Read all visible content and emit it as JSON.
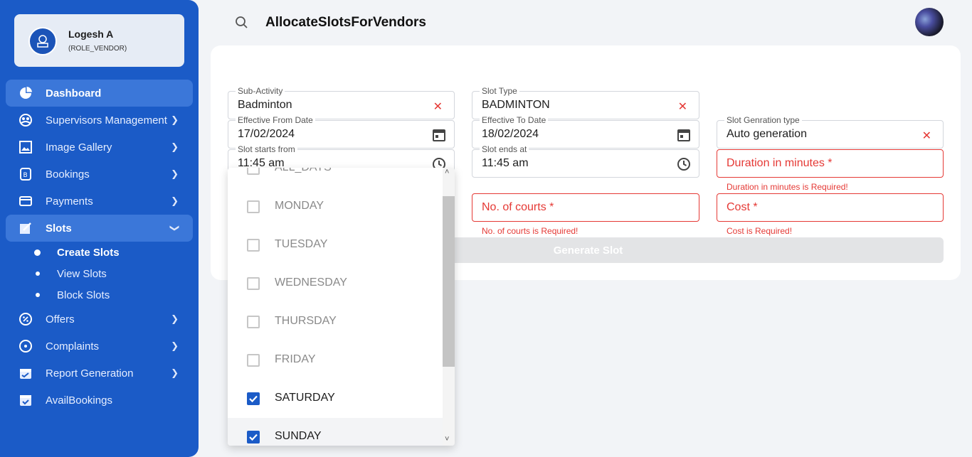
{
  "sidebar": {
    "profile": {
      "name": "Logesh A",
      "role": "(ROLE_VENDOR)"
    },
    "items": [
      {
        "label": "Dashboard",
        "icon": "pie-chart-icon"
      },
      {
        "label": "Supervisors Management",
        "icon": "supervisor-icon"
      },
      {
        "label": "Image Gallery",
        "icon": "image-gallery-icon"
      },
      {
        "label": "Bookings",
        "icon": "bookings-icon"
      },
      {
        "label": "Payments",
        "icon": "card-icon"
      },
      {
        "label": "Slots",
        "icon": "slots-icon"
      },
      {
        "label": "Offers",
        "icon": "offer-icon"
      },
      {
        "label": "Complaints",
        "icon": "complaint-icon"
      },
      {
        "label": "Report Generation",
        "icon": "report-icon"
      },
      {
        "label": "AvailBookings",
        "icon": "calendar-check-icon"
      }
    ],
    "slots_sub": [
      {
        "label": "Create Slots"
      },
      {
        "label": "View Slots"
      },
      {
        "label": "Block Slots"
      }
    ]
  },
  "header": {
    "title": "AllocateSlotsForVendors"
  },
  "form": {
    "sub_activity": {
      "label": "Sub-Activity",
      "value": "Badminton"
    },
    "slot_type": {
      "label": "Slot Type",
      "value": "BADMINTON"
    },
    "effective_from": {
      "label": "Effective From Date",
      "value": "17/02/2024"
    },
    "effective_to": {
      "label": "Effective To Date",
      "value": "18/02/2024"
    },
    "slot_gen_type": {
      "label": "Slot Genration type",
      "value": "Auto generation"
    },
    "slot_start": {
      "label": "Slot starts from",
      "value": "11:45 am"
    },
    "slot_end": {
      "label": "Slot ends at",
      "value": "11:45 am"
    },
    "duration": {
      "placeholder": "Duration in minutes *",
      "error": "Duration in minutes is Required!"
    },
    "courts": {
      "placeholder": "No. of courts *",
      "error": "No. of courts is Required!"
    },
    "cost": {
      "placeholder": "Cost *",
      "error": "Cost is Required!"
    },
    "generate_label": "Generate Slot"
  },
  "days_dropdown": {
    "options": [
      {
        "label": "ALL_DAYS",
        "checked": false
      },
      {
        "label": "MONDAY",
        "checked": false
      },
      {
        "label": "TUESDAY",
        "checked": false
      },
      {
        "label": "WEDNESDAY",
        "checked": false
      },
      {
        "label": "THURSDAY",
        "checked": false
      },
      {
        "label": "FRIDAY",
        "checked": false
      },
      {
        "label": "SATURDAY",
        "checked": true
      },
      {
        "label": "SUNDAY",
        "checked": true
      }
    ]
  },
  "colors": {
    "primary": "#1b5bc7",
    "error": "#e53935"
  }
}
